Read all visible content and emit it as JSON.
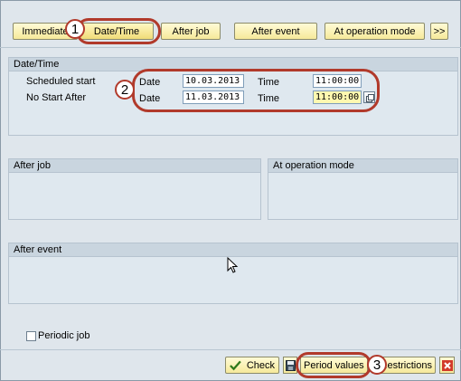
{
  "tabs": {
    "immediate": "Immediate",
    "date_time": "Date/Time",
    "after_job": "After job",
    "after_event": "After event",
    "at_operation_mode": "At operation mode",
    "more": ">>"
  },
  "date_time_group": {
    "title": "Date/Time",
    "scheduled_start": {
      "label": "Scheduled start",
      "date_label": "Date",
      "date_value": "10.03.2013",
      "time_label": "Time",
      "time_value": "11:00:00"
    },
    "no_start_after": {
      "label": "No Start After",
      "date_label": "Date",
      "date_value": "11.03.2013",
      "time_label": "Time",
      "time_value": "11:00:00"
    }
  },
  "after_job_group": {
    "title": "After job"
  },
  "at_operation_mode_group": {
    "title": "At operation mode"
  },
  "after_event_group": {
    "title": "After event"
  },
  "periodic_job": {
    "label": "Periodic job",
    "checked": false
  },
  "toolbar": {
    "check_label": "Check",
    "period_values_label": "Period values",
    "restrictions_label": "Restrictions"
  },
  "callouts": [
    "1",
    "2",
    "3"
  ],
  "colors": {
    "callout": "#b13a2b",
    "button": "#f6e99a",
    "highlight_field": "#fff8b0"
  },
  "icons": [
    "check-icon",
    "save-icon",
    "value-help-icon",
    "cancel-icon",
    "mouse-cursor-icon"
  ]
}
